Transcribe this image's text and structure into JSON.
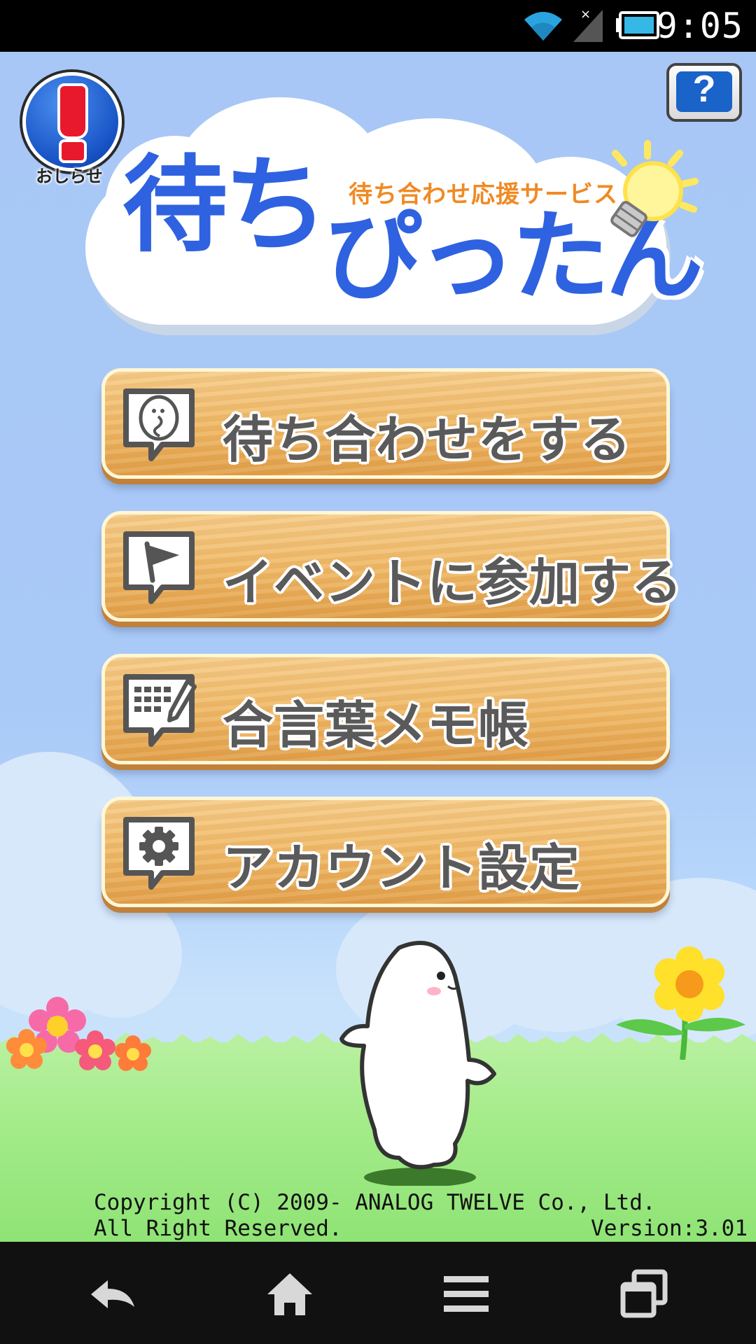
{
  "status_bar": {
    "time": "9:05",
    "icons": [
      "wifi-icon",
      "no-signal-icon",
      "battery-icon"
    ]
  },
  "header": {
    "info_badge_label": "おしらせ",
    "help_label": "?"
  },
  "logo": {
    "title_part1": "待ち",
    "title_part2": "ぴったん",
    "subtitle": "待ち合わせ応援サービス"
  },
  "menu": [
    {
      "label": "待ち合わせをする",
      "icon": "speech-bubble-face-icon"
    },
    {
      "label": "イベントに参加する",
      "icon": "flag-icon"
    },
    {
      "label": "合言葉メモ帳",
      "icon": "keyboard-pencil-icon"
    },
    {
      "label": "アカウント設定",
      "icon": "gear-icon"
    }
  ],
  "footer": {
    "copyright_line1": "Copyright (C) 2009- ANALOG TWELVE Co., Ltd.",
    "copyright_line2": "All Right Reserved.",
    "version": "Version:3.01"
  },
  "navbar": {
    "icons": [
      "back-icon",
      "home-icon",
      "menu-icon",
      "recent-apps-icon"
    ]
  },
  "colors": {
    "sky": "#a8c7f6",
    "grass": "#a6ec8c",
    "logo_blue": "#2f62e0",
    "subtitle_orange": "#f08a24",
    "wood": "#efb865"
  }
}
